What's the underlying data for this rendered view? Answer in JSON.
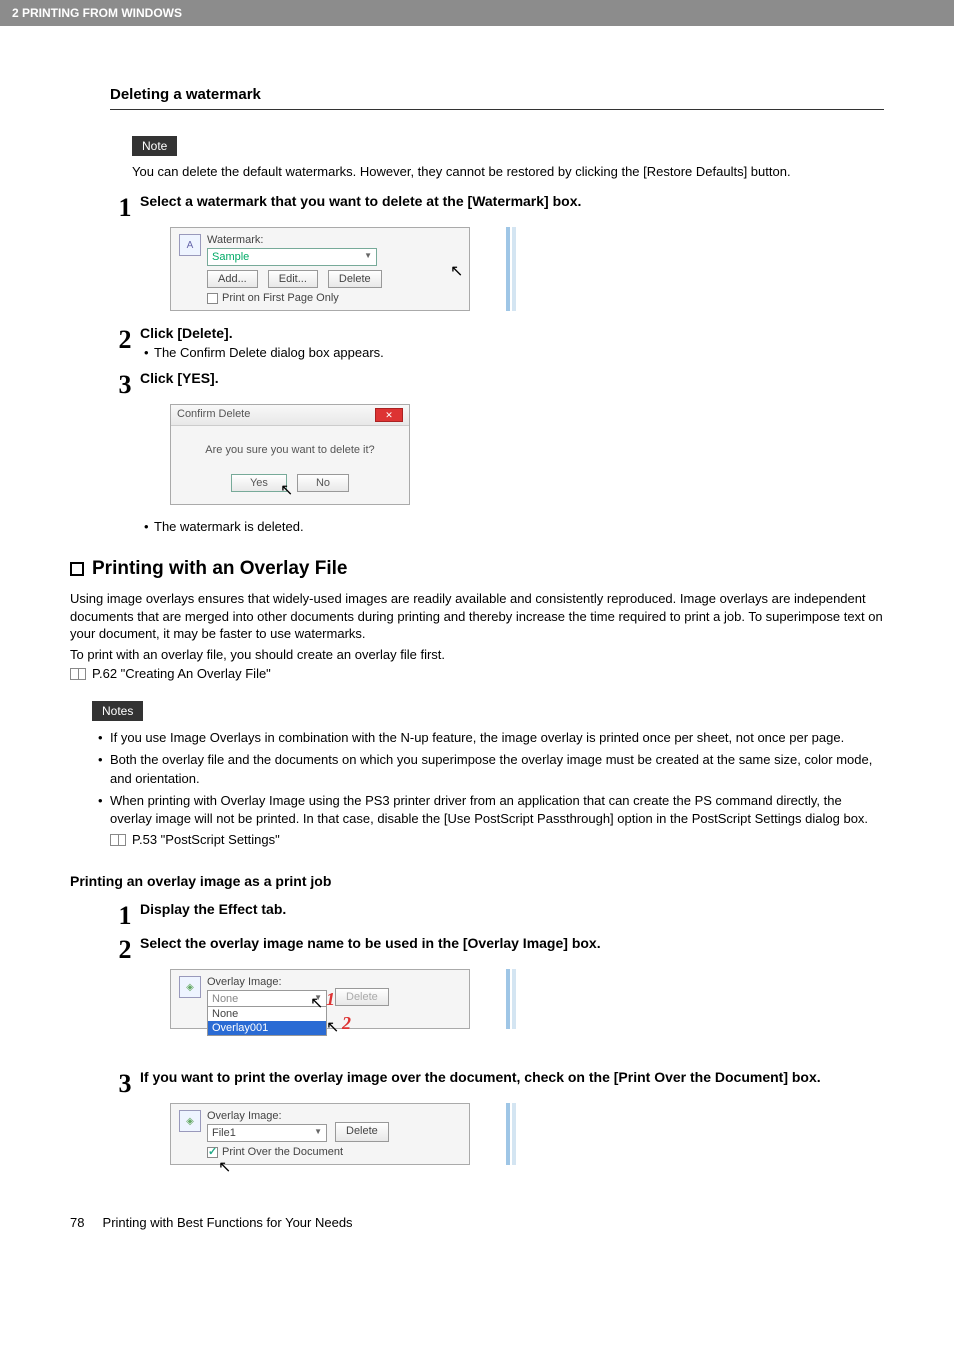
{
  "header_band": "2 PRINTING FROM WINDOWS",
  "deleting_watermark": {
    "heading": "Deleting a watermark",
    "note_label": "Note",
    "note_text": "You can delete the default watermarks.  However, they cannot be restored by clicking the [Restore Defaults] button.",
    "step1_title": "Select a watermark that you want to delete at the [Watermark] box.",
    "fig1": {
      "label": "Watermark:",
      "select_value": "Sample",
      "btn_add": "Add...",
      "btn_edit": "Edit...",
      "btn_delete": "Delete",
      "check_label": "Print on First Page Only"
    },
    "step2_title": "Click [Delete].",
    "step2_bullet": "The Confirm Delete dialog box appears.",
    "step3_title": "Click [YES].",
    "dialog": {
      "title": "Confirm Delete",
      "message": "Are you sure you want to delete it?",
      "btn_yes": "Yes",
      "btn_no": "No"
    },
    "step3_bullet": "The watermark is deleted."
  },
  "overlay_section": {
    "heading": "Printing with an Overlay File",
    "para1": "Using image overlays ensures that widely-used images are readily available and consistently reproduced.  Image overlays are independent documents that are merged into other documents during printing and thereby increase the time required to print a job.  To superimpose text on your document, it may be faster to use watermarks.",
    "para2": "To print with an overlay file, you should create an overlay file first.",
    "ref1": "P.62 \"Creating An Overlay File\"",
    "notes_label": "Notes",
    "note_items": [
      "If you use Image Overlays in combination with the N-up feature, the image overlay is printed once per sheet, not once per page.",
      "Both the overlay file and the documents on which you superimpose the overlay image must be created at the same size, color mode, and orientation.",
      "When printing with Overlay Image using the PS3 printer driver from an application that can create the PS command directly, the overlay image will not be printed.  In that case, disable the [Use PostScript Passthrough] option in the PostScript Settings dialog box."
    ],
    "sub_ref": "P.53 \"PostScript Settings\"",
    "print_heading": "Printing an overlay image as a print job",
    "step1": "Display the Effect tab.",
    "step2": "Select the overlay image name to be used in the [Overlay Image] box.",
    "fig2": {
      "label": "Overlay Image:",
      "select_value": "None",
      "btn_delete": "Delete",
      "opt_none": "None",
      "opt_overlay": "Overlay001"
    },
    "step3": "If you want to print the overlay image over the document,  check on the [Print Over the Document] box.",
    "fig3": {
      "label": "Overlay Image:",
      "select_value": "File1",
      "btn_delete": "Delete",
      "check_label": "Print Over the Document"
    }
  },
  "footer": {
    "page_num": "78",
    "footer_text": "Printing with Best Functions for Your Needs"
  }
}
